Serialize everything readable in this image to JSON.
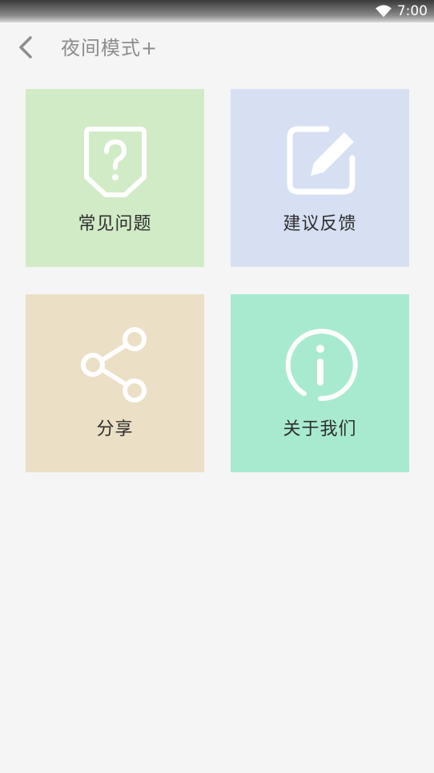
{
  "status_bar": {
    "time": "7:00",
    "wifi_icon": "wifi-icon"
  },
  "header": {
    "back_icon": "chevron-left-icon",
    "title": "夜间模式+"
  },
  "menu": [
    {
      "label": "常见问题",
      "icon": "question-badge-icon",
      "color": "#d1ebc6"
    },
    {
      "label": "建议反馈",
      "icon": "edit-icon",
      "color": "#d7e0f2"
    },
    {
      "label": "分享",
      "icon": "share-icon",
      "color": "#ebdfc5"
    },
    {
      "label": "关于我们",
      "icon": "info-icon",
      "color": "#a8ead0"
    }
  ]
}
